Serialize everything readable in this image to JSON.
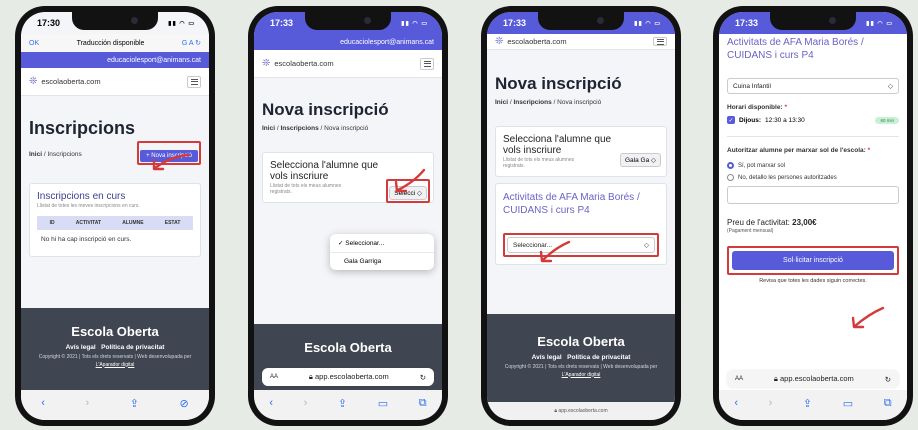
{
  "phones": [
    {
      "time": "17:30",
      "translation": {
        "ok": "OK",
        "title": "Traducción disponible",
        "icons": "G A ↻"
      },
      "email": "educaciolesport@animans.cat",
      "site": "escolaoberta.com",
      "title": "Inscripcions",
      "breadcrumb": {
        "home": "Inici",
        "sep": " / ",
        "current": "Inscripcions"
      },
      "new_button": "+ Nova inscripció",
      "card": {
        "title": "Inscripcions en curs",
        "subtitle": "Llistat de totes les meves inscripcions en curs.",
        "columns": [
          "ID",
          "ACTIVITAT",
          "ALUMNE",
          "ESTAT"
        ],
        "empty": "No hi ha cap inscripció en curs."
      },
      "footer": {
        "title": "Escola Oberta",
        "link_legal": "Avís legal",
        "link_privacy": "Política de privacitat",
        "copyright": "Copyright © 2021 | Tots els drets reservats | Web desenvolupada per",
        "dev": "L'Aparador digital"
      }
    },
    {
      "time": "17:33",
      "email": "educaciolesport@animans.cat",
      "site": "escolaoberta.com",
      "title": "Nova inscripció",
      "breadcrumb": {
        "home": "Inici",
        "mid": "Inscripcions",
        "current": "Nova inscripció"
      },
      "card": {
        "title": "Selecciona l'alumne que vols inscriure",
        "subtitle": "Llistat de tots els meus alumnes registrats.",
        "select_value": "Selecci ◇"
      },
      "dropdown": [
        "✓ Seleccionar...",
        "Gala Garriga"
      ],
      "footer_title": "Escola Oberta",
      "url": "app.escolaoberta.com",
      "url_aa": "AA"
    },
    {
      "time": "17:33",
      "site": "escolaoberta.com",
      "title": "Nova inscripció",
      "breadcrumb": {
        "home": "Inici",
        "mid": "Inscripcions",
        "current": "Nova inscripció"
      },
      "card": {
        "title": "Selecciona l'alumne que vols inscriure",
        "subtitle": "Llistat de tots els meus alumnes registrats.",
        "select_value": "Gala Ga ◇"
      },
      "activity": {
        "title": "Activitats de AFA Maria Borés / CUIDANS i curs P4",
        "select": "Seleccionar...",
        "arrow": "◇"
      },
      "footer": {
        "title": "Escola Oberta",
        "link_legal": "Avís legal",
        "link_privacy": "Política de privacitat",
        "copyright": "Copyright © 2021 | Tots els drets reservats | Web desenvolupada per",
        "dev": "L'Aparador digital"
      },
      "url": "app.escolaoberta.com"
    },
    {
      "time": "17:33",
      "activity_title": "Activitats de AFA Maria Borés / CUIDANS i curs P4",
      "select": "Cuina Infantil",
      "select_arrow": "◇",
      "schedule_label": "Horari disponible:",
      "required": "*",
      "schedule": {
        "day": "Dijous:",
        "time": "12:30 a 13:30",
        "badge": "60 min"
      },
      "auth_label": "Autoritzar alumne per marxar sol de l'escola:",
      "radio_yes": "Sí, pot marxar sol",
      "radio_no": "No, detallo les persones autoritzades",
      "price_label": "Preu de l'activitat:",
      "price_value": "23,00€",
      "price_sub": "(Pagament mensual)",
      "submit": "Sol·licitar inscripció",
      "hint": "Revisa que totes les dades siguin correctes.",
      "url": "app.escolaoberta.com",
      "url_aa": "AA"
    }
  ],
  "colors": {
    "accent": "#575ad9",
    "highlight": "#d53a3a",
    "footer": "#3f4652"
  }
}
